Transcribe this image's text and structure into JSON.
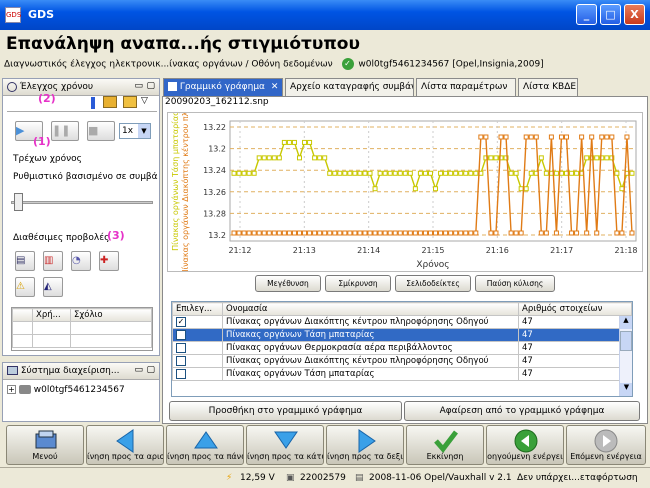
{
  "window": {
    "title": "GDS",
    "min_glyph": "_",
    "max_glyph": "□",
    "close_glyph": "X"
  },
  "heading": "Επανάληψη αναπα...ής στιγμιότυπου",
  "breadcrumb": {
    "path": "Διαγνωστικός έλεγχος ηλεκτρονικ...ίνακας οργάνων / Οθόνη δεδομένων",
    "vehicle": "w0l0tgf5461234567 [Opel,Insignia,2009]"
  },
  "time_panel": {
    "title": "Έλεγχος χρόνου",
    "marker2": "(2)",
    "marker1": "(1)",
    "marker3": "(3)",
    "speed": "1x",
    "current_time_label": "Τρέχων χρόνος",
    "rate_label": "Ρυθμιστικό βασισμένο σε συμβά",
    "views_label": "Διαθέσιμες προβολές",
    "slider_value": 0.02
  },
  "notes_table": {
    "headers": [
      "",
      "Χρή...",
      "Σχόλιο"
    ]
  },
  "system_panel": {
    "title": "Σύστημα διαχείριση...",
    "tree_item": "w0l0tgf5461234567"
  },
  "tabs": [
    {
      "label": "Γραμμικό γράφημα",
      "active": true
    },
    {
      "label": "Αρχείο καταγραφής συμβάντων"
    },
    {
      "label": "Λίστα παραμέτρων"
    },
    {
      "label": "Λίστα ΚΒΔΕ"
    }
  ],
  "file_name": "20090203_162112.snp",
  "chart_data": {
    "type": "line",
    "y_axis_label_orange": "Πίνακας οργάνων Διακόπτης κέντρου πληροφό",
    "y_axis_label_yellow": "Πίνακας οργάνων Τάση μπαταρίας",
    "xlabel": "Χρόνος",
    "x_ticks": [
      "21:12",
      "21:13",
      "21:14",
      "21:15",
      "21:16",
      "21:17",
      "21:18"
    ],
    "y_ticks": [
      "13.22",
      "13.2",
      "13.24",
      "13.26",
      "13.28",
      "13.2"
    ],
    "colors": {
      "orange": "#e07b16",
      "yellow": "#c8c800"
    },
    "series": [
      {
        "name": "Πίνακας οργάνων Τάση μπαταρίας",
        "color": "#c8c800",
        "values": [
          13.26,
          13.26,
          13.26,
          13.26,
          13.26,
          13.28,
          13.28,
          13.28,
          13.28,
          13.28,
          13.3,
          13.3,
          13.3,
          13.28,
          13.3,
          13.3,
          13.28,
          13.28,
          13.28,
          13.26,
          13.26,
          13.26,
          13.26,
          13.26,
          13.26,
          13.26,
          13.26,
          13.26,
          13.24,
          13.26,
          13.26,
          13.26,
          13.26,
          13.26,
          13.26,
          13.26,
          13.24,
          13.26,
          13.26,
          13.26,
          13.24,
          13.26,
          13.26,
          13.26,
          13.26,
          13.26,
          13.26,
          13.26,
          13.26,
          13.26,
          13.28,
          13.28,
          13.28,
          13.28,
          13.28,
          13.26,
          13.26,
          13.24,
          13.24,
          13.26,
          13.26,
          13.28,
          13.26,
          13.26,
          13.26,
          13.26,
          13.26,
          13.26,
          13.26,
          13.26,
          13.28,
          13.28,
          13.28,
          13.28,
          13.28,
          13.28,
          13.26,
          13.24,
          13.26,
          13.26
        ]
      },
      {
        "name": "Πίνακας οργάνων Διακόπτης κέντρου πληροφόρησης Οδηγού",
        "color": "#e07b16",
        "values": [
          0,
          0,
          0,
          0,
          0,
          0,
          0,
          0,
          0,
          0,
          0,
          0,
          0,
          0,
          0,
          0,
          0,
          0,
          0,
          0,
          0,
          0,
          0,
          0,
          0,
          0,
          0,
          0,
          0,
          0,
          0,
          0,
          0,
          0,
          0,
          0,
          0,
          0,
          0,
          0,
          0,
          0,
          0,
          0,
          0,
          0,
          0,
          0,
          0,
          1,
          1,
          0,
          0,
          1,
          1,
          0,
          0,
          0,
          1,
          1,
          1,
          0,
          0,
          1,
          0,
          1,
          1,
          0,
          0,
          1,
          0,
          1,
          0,
          1,
          1,
          1,
          0,
          0,
          1,
          0
        ]
      }
    ]
  },
  "chart_buttons": [
    "Μεγέθυνση",
    "Σμίκρυνση",
    "Σελιδοδείκτες",
    "Παύση κύλισης"
  ],
  "param_table": {
    "headers": [
      "Επιλεγ...",
      "Ονομασία",
      "Αριθμός στοιχείων"
    ],
    "rows": [
      {
        "checked": true,
        "name": "Πίνακας οργάνων Διακόπτης κέντρου πληροφόρησης Οδηγού",
        "count": "47"
      },
      {
        "checked": true,
        "selected": true,
        "name": "Πίνακας οργάνων Τάση μπαταρίας",
        "count": "47"
      },
      {
        "checked": false,
        "name": "Πίνακας οργάνων Θερμοκρασία αέρα περιβάλλοντος",
        "count": "47"
      },
      {
        "checked": false,
        "name": "Πίνακας οργάνων Διακόπτης κέντρου πληροφόρησης Οδηγού",
        "count": "47"
      },
      {
        "checked": false,
        "name": "Πίνακας οργάνων Τάση μπαταρίας",
        "count": "47"
      }
    ]
  },
  "add_to_chart": "Προσθήκη στο γραμμικό γράφημα",
  "remove_from_chart": "Αφαίρεση από το γραμμικό γράφημα",
  "nav": {
    "menu": "Μενού",
    "back": "ίνηση προς τα αριστ",
    "up": "ίνηση προς τα πάνω",
    "down": "ίνηση προς τα κάτω",
    "forward": "ίνηση προς τα δεξιά",
    "start": "Εκκίνηση",
    "prev": "οηγούμενη ενέργει",
    "next": "Επόμενη ενέργεια"
  },
  "status": {
    "voltage": "12,59 V",
    "id": "22002579",
    "date": "2008-11-06 Opel/Vauxhall v 2.1",
    "msg": "Δεν υπάρχει...εταφόρτωση"
  }
}
